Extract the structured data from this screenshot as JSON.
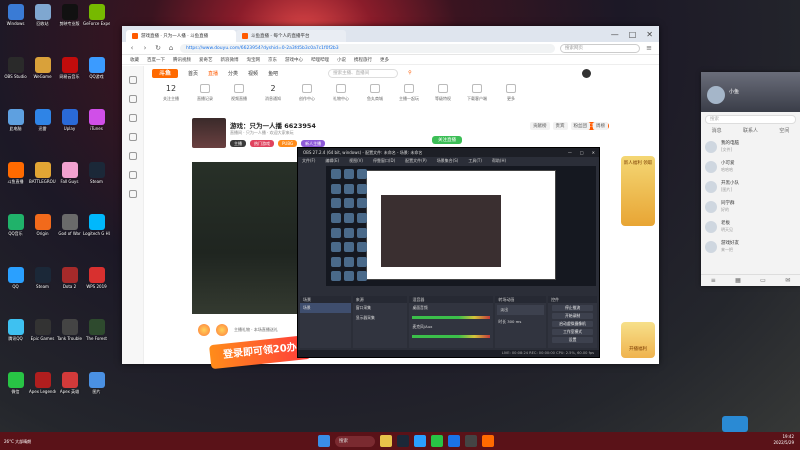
{
  "desktop": {
    "icons": [
      {
        "label": "Windows",
        "color": "#3a7bd5"
      },
      {
        "label": "OBS Studio",
        "color": "#2a2a2a"
      },
      {
        "label": "此电脑",
        "color": "#5ea0e0"
      },
      {
        "label": "斗鱼直播",
        "color": "#ff6a00"
      },
      {
        "label": "QQ音乐",
        "color": "#20b26a"
      },
      {
        "label": "QQ",
        "color": "#2aa0ff"
      },
      {
        "label": "腾讯QQ",
        "color": "#3ec1f1"
      },
      {
        "label": "微信",
        "color": "#28c445"
      },
      {
        "label": "回收站",
        "color": "#7fa7d0"
      },
      {
        "label": "WeGame",
        "color": "#d9a13a"
      },
      {
        "label": "迅雷",
        "color": "#2f84e6"
      },
      {
        "label": "BATTLEGROUNDS",
        "color": "#e2a534"
      },
      {
        "label": "Origin",
        "color": "#f26a1b"
      },
      {
        "label": "Steam",
        "color": "#1b2838"
      },
      {
        "label": "Epic Games",
        "color": "#333333"
      },
      {
        "label": "Apex Legends",
        "color": "#b01e1e"
      },
      {
        "label": "剪映专业版",
        "color": "#111111"
      },
      {
        "label": "网易云音乐",
        "color": "#c20c0c"
      },
      {
        "label": "Uplay",
        "color": "#2a6ad8"
      },
      {
        "label": "Fall Guys",
        "color": "#f2a1d0"
      },
      {
        "label": "God of War",
        "color": "#6a6a6a"
      },
      {
        "label": "Dota 2",
        "color": "#a52a2a"
      },
      {
        "label": "Tank Trouble",
        "color": "#444444"
      },
      {
        "label": "Apex 英雄",
        "color": "#d23a3a"
      },
      {
        "label": "GeForce Experience",
        "color": "#76b900"
      },
      {
        "label": "QQ游戏",
        "color": "#3b9bff"
      },
      {
        "label": "iTunes",
        "color": "#d04fe8"
      },
      {
        "label": "Steam",
        "color": "#1b2838"
      },
      {
        "label": "Logitech G HUB",
        "color": "#00b8fc"
      },
      {
        "label": "WPS 2019",
        "color": "#d8302f"
      },
      {
        "label": "The Forest",
        "color": "#2e4a2e"
      },
      {
        "label": "图片",
        "color": "#4a90e2"
      }
    ]
  },
  "browser": {
    "tab_label": "游戏直播 · 只为一人播 · 斗鱼直播",
    "tab_label2": "斗鱼直播 - 每个人的直播平台",
    "url": "https://www.douyu.com/6623954?dyshid=0-2a3fd5b3c0a7c1f0f2b3",
    "search_placeholder": "搜索网页",
    "bookmarks": [
      "收藏",
      "百度一下",
      "腾讯视频",
      "爱奇艺",
      "新浪微博",
      "淘宝网",
      "京东",
      "游戏中心",
      "哔哩哔哩",
      "小说",
      "携程旅行",
      "更多"
    ],
    "window_controls": [
      "—",
      "□",
      "✕"
    ]
  },
  "douyu": {
    "logo": "斗鱼",
    "menu": [
      "首页",
      "直播",
      "分类",
      "视频",
      "鱼吧"
    ],
    "active_menu": "直播",
    "search_placeholder": "搜索主播、直播间",
    "toolbar": [
      {
        "num": "12",
        "label": "关注主播"
      },
      {
        "num": "",
        "label": "直播记录"
      },
      {
        "num": "",
        "label": "视频直播"
      },
      {
        "num": "2",
        "label": "消息通知"
      },
      {
        "num": "",
        "label": "创作中心"
      },
      {
        "num": "",
        "label": "礼物中心"
      },
      {
        "num": "",
        "label": "鱼丸商城"
      },
      {
        "num": "",
        "label": "主播一起玩"
      },
      {
        "num": "",
        "label": "等级特权"
      },
      {
        "num": "",
        "label": "下载客户端"
      },
      {
        "num": "",
        "label": "更多"
      }
    ],
    "pc_live_label": "PC客户端",
    "room": {
      "title": "游戏：只为一人播 6623954",
      "subtitle": "直播间 · 只为一人播 · 欢迎大家来玩",
      "tags": [
        {
          "label": "主播",
          "color": "#3a3a3a"
        },
        {
          "label": "热门游戏",
          "color": "#e0435e"
        },
        {
          "label": "PUBG",
          "color": "#ff8c1a"
        },
        {
          "label": "新人主播",
          "color": "#8e5ad8"
        }
      ],
      "follow_label": "关注直播",
      "rank_tabs": [
        "贡献榜",
        "贵宾",
        "粉丝团",
        "周榜"
      ]
    },
    "gift_text": "主播礼物 · 本场直播送礼",
    "promo_badge_top": "新人福利 领取",
    "promo_badge_bottom": "开播福利",
    "banner_text": "登录即可领20办"
  },
  "obs": {
    "title": "OBS 27.2.4 (64 bit, windows) - 配置文件: 未命名 - 场景: 未命名",
    "menu": [
      "文件(F)",
      "编辑(E)",
      "视图(V)",
      "停靠窗口(D)",
      "配置文件(P)",
      "场景集合(S)",
      "工具(T)",
      "帮助(H)"
    ],
    "docks": {
      "scenes": {
        "title": "场景",
        "items": [
          "场景"
        ]
      },
      "sources": {
        "title": "来源",
        "items": [
          "窗口采集",
          "显示器采集"
        ]
      },
      "mixer": {
        "title": "混音器",
        "items": [
          "桌面音频",
          "麦克风/Aux"
        ]
      },
      "transitions": {
        "title": "转场动画",
        "items": [
          "淡出",
          "时长 300 ms"
        ]
      },
      "controls": {
        "title": "控件",
        "buttons": [
          "停止推流",
          "开始录制",
          "启动虚拟摄像机",
          "工作室模式",
          "设置",
          "退出"
        ]
      }
    },
    "status": "LIVE: 00:08:24   REC: 00:00:00   CPU: 2.5%, 60.00 fps"
  },
  "qq": {
    "name": "小鱼",
    "search_placeholder": "搜索",
    "tabs": [
      "消息",
      "联系人",
      "空间"
    ],
    "contacts": [
      {
        "name": "我的电脑",
        "sub": "[文件]"
      },
      {
        "name": "小可爱",
        "sub": "哈哈哈"
      },
      {
        "name": "开黑小队",
        "sub": "[图片]"
      },
      {
        "name": "同学群",
        "sub": "好的"
      },
      {
        "name": "老板",
        "sub": "明天见"
      },
      {
        "name": "游戏好友",
        "sub": "来一把"
      }
    ]
  },
  "taskbar": {
    "weather": "26°C 大部晴朗",
    "search_label": "搜索",
    "time": "19:42",
    "date": "2022/5/29"
  }
}
